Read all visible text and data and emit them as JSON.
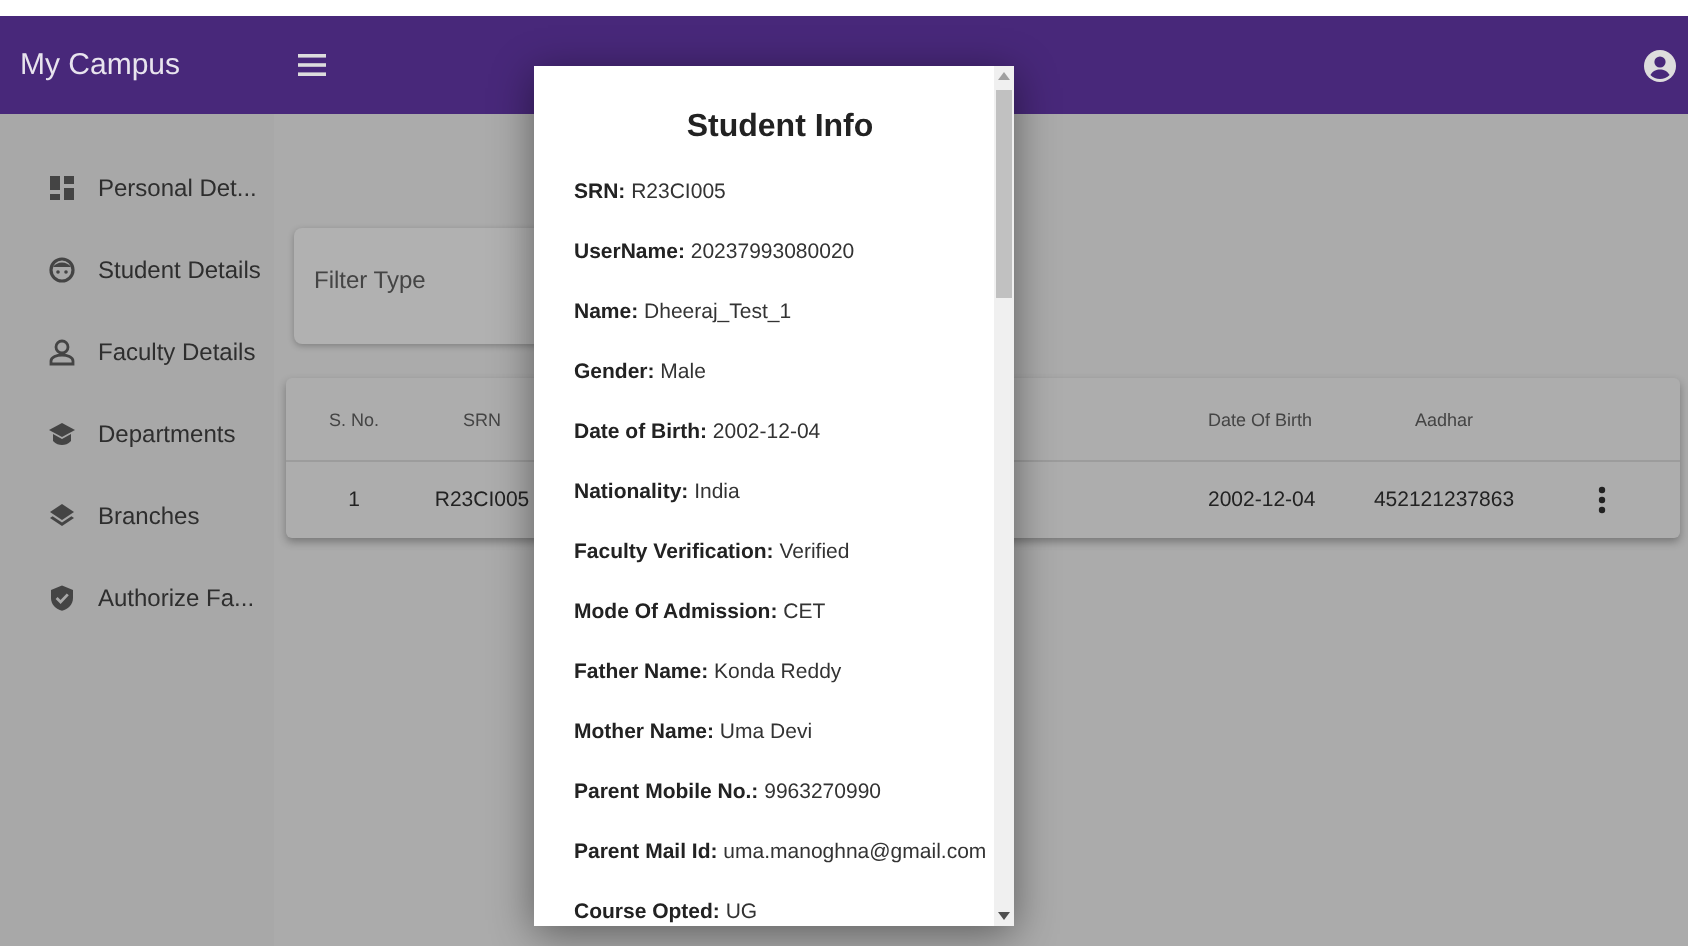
{
  "app_bar": {
    "title": "My Campus"
  },
  "sidebar": {
    "items": [
      {
        "label": "Personal Det..."
      },
      {
        "label": "Student Details"
      },
      {
        "label": "Faculty Details"
      },
      {
        "label": "Departments"
      },
      {
        "label": "Branches"
      },
      {
        "label": "Authorize Fa..."
      }
    ]
  },
  "filter": {
    "label": "Filter Type"
  },
  "table": {
    "columns": [
      "S. No.",
      "SRN",
      "Date Of Birth",
      "Aadhar"
    ],
    "rows": [
      [
        "1",
        "R23CI005",
        "2002-12-04",
        "452121237863"
      ]
    ]
  },
  "dialog": {
    "title": "Student Info",
    "fields": [
      {
        "label": "SRN:",
        "value": "R23CI005"
      },
      {
        "label": "UserName:",
        "value": "20237993080020"
      },
      {
        "label": "Name:",
        "value": "Dheeraj_Test_1"
      },
      {
        "label": "Gender:",
        "value": "Male"
      },
      {
        "label": "Date of Birth:",
        "value": "2002-12-04"
      },
      {
        "label": "Nationality:",
        "value": "India"
      },
      {
        "label": "Faculty Verification:",
        "value": "Verified"
      },
      {
        "label": "Mode Of Admission:",
        "value": "CET"
      },
      {
        "label": "Father Name:",
        "value": "Konda Reddy"
      },
      {
        "label": "Mother Name:",
        "value": "Uma Devi"
      },
      {
        "label": "Parent Mobile No.:",
        "value": "9963270990"
      },
      {
        "label": "Parent Mail Id:",
        "value": "uma.manoghna@gmail.com"
      },
      {
        "label": "Course Opted:",
        "value": "UG"
      }
    ]
  }
}
